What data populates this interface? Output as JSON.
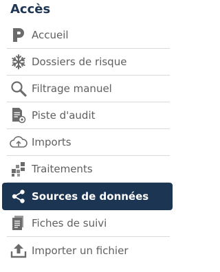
{
  "section": {
    "title": "Accès"
  },
  "nav": {
    "items": [
      {
        "label": "Accueil",
        "icon": "p-logo-icon"
      },
      {
        "label": "Dossiers de risque",
        "icon": "snowflake-icon"
      },
      {
        "label": "Filtrage manuel",
        "icon": "magnifier-icon"
      },
      {
        "label": "Piste d'audit",
        "icon": "audit-document-icon"
      },
      {
        "label": "Imports",
        "icon": "cloud-upload-icon"
      },
      {
        "label": "Traitements",
        "icon": "processing-squares-icon"
      },
      {
        "label": "Sources de données",
        "icon": "share-nodes-icon",
        "active": true
      },
      {
        "label": "Fiches de suivi",
        "icon": "tracking-sheets-icon"
      },
      {
        "label": "Importer un fichier",
        "icon": "upload-tray-icon"
      }
    ]
  },
  "colors": {
    "title": "#1f3554",
    "active_bg": "#1c3553",
    "icon_gray": "#6b6b6b",
    "label_gray": "#5f5f5f",
    "divider": "#d9d9d9"
  }
}
